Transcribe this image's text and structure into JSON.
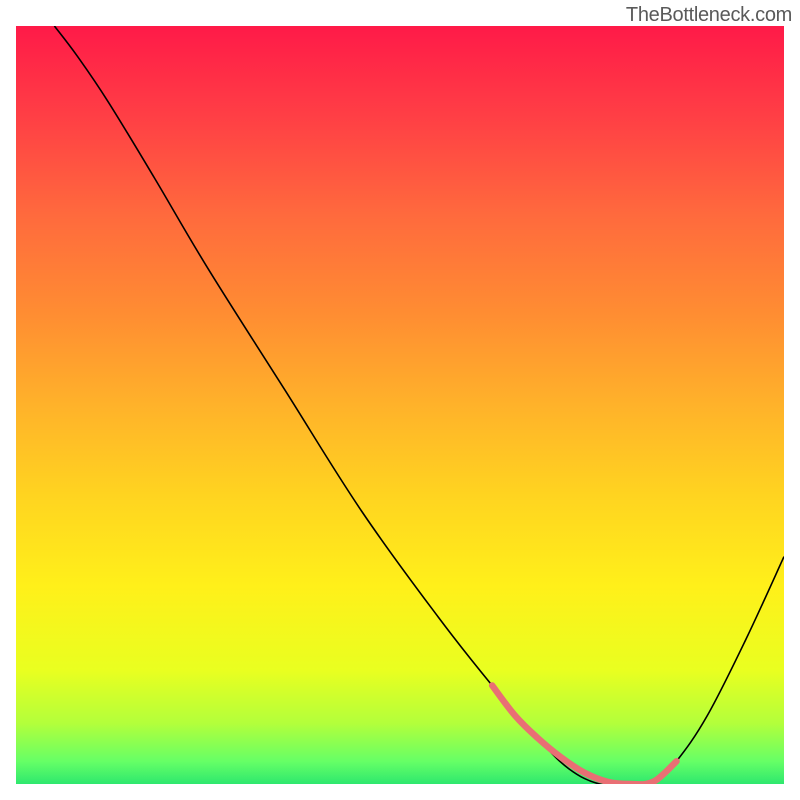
{
  "watermark": "TheBottleneck.com",
  "chart_data": {
    "type": "line",
    "title": "",
    "xlabel": "",
    "ylabel": "",
    "xlim": [
      0,
      100
    ],
    "ylim": [
      0,
      100
    ],
    "background_gradient": {
      "stops": [
        {
          "offset": 0.0,
          "color": "#ff1a48"
        },
        {
          "offset": 0.12,
          "color": "#ff3f45"
        },
        {
          "offset": 0.25,
          "color": "#ff6a3d"
        },
        {
          "offset": 0.38,
          "color": "#ff8d32"
        },
        {
          "offset": 0.5,
          "color": "#ffb22a"
        },
        {
          "offset": 0.62,
          "color": "#ffd420"
        },
        {
          "offset": 0.74,
          "color": "#fff01a"
        },
        {
          "offset": 0.85,
          "color": "#e9ff20"
        },
        {
          "offset": 0.92,
          "color": "#b3ff3b"
        },
        {
          "offset": 0.97,
          "color": "#66ff66"
        },
        {
          "offset": 1.0,
          "color": "#2ee86e"
        }
      ]
    },
    "series": [
      {
        "name": "curve",
        "color": "#000000",
        "width": 1.6,
        "x": [
          5,
          8,
          12,
          18,
          25,
          35,
          45,
          55,
          62,
          68,
          72,
          76,
          80,
          83,
          86,
          90,
          95,
          100
        ],
        "y": [
          100,
          96,
          90,
          80,
          68,
          52,
          36,
          22,
          13,
          6,
          2,
          0,
          0,
          0,
          3,
          9,
          19,
          30
        ]
      },
      {
        "name": "highlight",
        "color": "#e96f74",
        "width": 6.5,
        "x": [
          62,
          65,
          68,
          71,
          74,
          77,
          80,
          83,
          86
        ],
        "y": [
          13,
          9,
          6,
          3.5,
          1.5,
          0.3,
          0,
          0.3,
          3
        ]
      }
    ]
  }
}
